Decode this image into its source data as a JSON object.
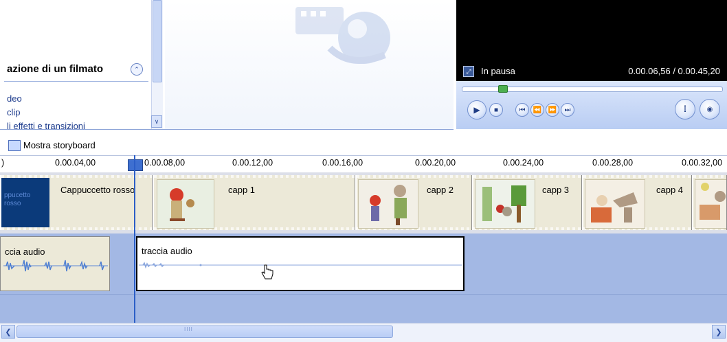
{
  "task_pane": {
    "title": "azione di un filmato",
    "links": [
      "deo",
      "clip",
      "li effetti e transizioni"
    ]
  },
  "monitor": {
    "status": "In pausa",
    "time": "0.00.06,56 / 0.00.45,20",
    "seek_fraction": 0.145
  },
  "storyboard": {
    "label": "Mostra storyboard"
  },
  "ruler": {
    "ticks": [
      ")",
      "0.00.04,00",
      "0.00.08,00",
      "0.00.12,00",
      "0.00.16,00",
      "0.00.20,00",
      "0.00.24,00",
      "0.00.28,00",
      "0.00.32,00"
    ]
  },
  "video_clips": [
    {
      "title": "Cappuccetto rosso",
      "thumb_text": "ppucetto rosso"
    },
    {
      "title": "capp 1"
    },
    {
      "title": "capp 2"
    },
    {
      "title": "capp 3"
    },
    {
      "title": "capp 4"
    }
  ],
  "audio_clips": [
    {
      "title": "ccia audio"
    },
    {
      "title": "traccia audio"
    }
  ],
  "scrollbar": {
    "grip": "IIII"
  },
  "colors": {
    "track_blue": "#a3b8e4",
    "clip_beige": "#ece9d8",
    "playhead": "#2b5ec7",
    "monitor_bg": "#000000"
  }
}
